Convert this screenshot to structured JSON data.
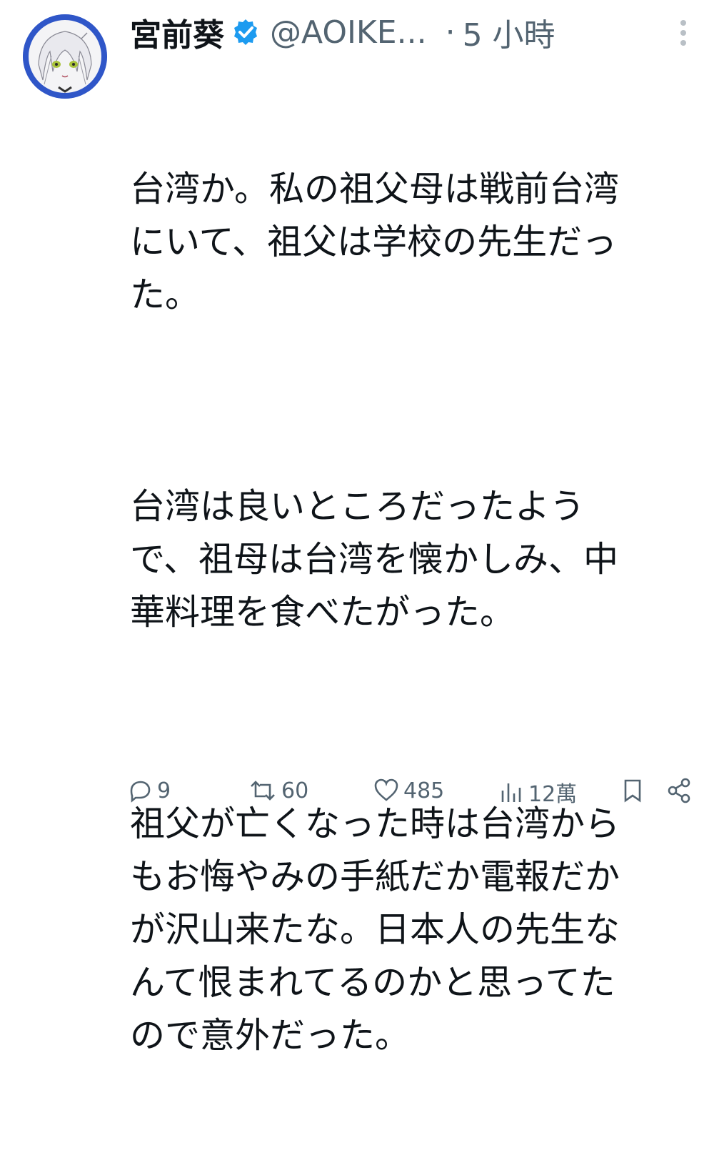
{
  "tweet": {
    "display_name": "宮前葵",
    "handle": "@AOIKE...",
    "separator": "·",
    "time": "5 小時",
    "verified_color": "#1d9bf0",
    "paragraphs": [
      "台湾か。私の祖父母は戦前台湾\nにいて、祖父は学校の先生だっ\nた。",
      "台湾は良いところだったよう\nで、祖母は台湾を懐かしみ、中\n華料理を食べたがった。",
      "祖父が亡くなった時は台湾から\nもお悔やみの手紙だか電報だか\nが沢山来たな。日本人の先生な\nんて恨まれてるのかと思ってた\nので意外だった。"
    ],
    "actions": {
      "reply_count": "9",
      "retweet_count": "60",
      "like_count": "485",
      "view_count": "12萬"
    },
    "icons": {
      "verified": "verified-badge-icon",
      "more": "more-options-icon",
      "reply": "reply-icon",
      "retweet": "retweet-icon",
      "like": "heart-icon",
      "views": "views-chart-icon",
      "bookmark": "bookmark-icon",
      "share": "share-icon"
    }
  }
}
